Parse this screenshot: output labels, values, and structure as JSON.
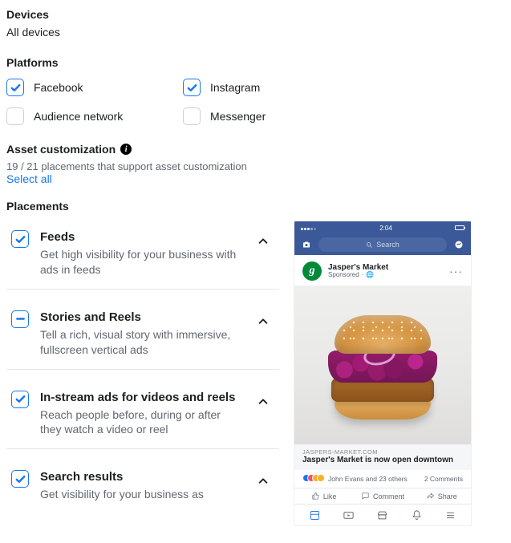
{
  "devices": {
    "heading": "Devices",
    "value": "All devices"
  },
  "platforms": {
    "heading": "Platforms",
    "items": [
      {
        "label": "Facebook",
        "checked": true
      },
      {
        "label": "Instagram",
        "checked": true
      },
      {
        "label": "Audience network",
        "checked": false
      },
      {
        "label": "Messenger",
        "checked": false
      }
    ]
  },
  "asset_customization": {
    "heading": "Asset customization",
    "subtext": "19 / 21 placements that support asset customization",
    "select_all": "Select all"
  },
  "placements": {
    "heading": "Placements",
    "items": [
      {
        "title": "Feeds",
        "desc": "Get high visibility for your business with ads in feeds",
        "state": "checked"
      },
      {
        "title": "Stories and Reels",
        "desc": "Tell a rich, visual story with immersive, fullscreen vertical ads",
        "state": "indeterminate"
      },
      {
        "title": "In-stream ads for videos and reels",
        "desc": "Reach people before, during or after they watch a video or reel",
        "state": "checked"
      },
      {
        "title": "Search results",
        "desc": "Get visibility for your business as",
        "state": "checked"
      }
    ]
  },
  "preview": {
    "statusbar_time": "2:04",
    "search_placeholder": "Search",
    "page_name": "Jasper's Market",
    "sponsored": "Sponsored",
    "domain": "JASPERS-MARKET.COM",
    "headline": "Jasper's Market is now open downtown",
    "reactions_text": "John Evans and 23 others",
    "comments_text": "2 Comments",
    "action_like": "Like",
    "action_comment": "Comment",
    "action_share": "Share"
  }
}
